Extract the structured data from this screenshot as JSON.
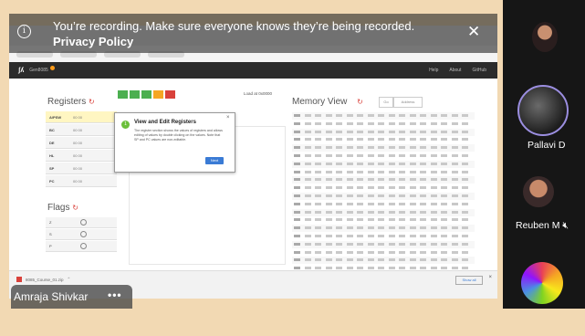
{
  "banner": {
    "message": "You’re recording. Make sure everyone knows they’re being recorded.",
    "link": "Privacy Policy",
    "info_icon": "info-icon",
    "close_icon": "close-icon"
  },
  "participants": [
    {
      "name": "",
      "icon": "avatar-photo"
    },
    {
      "name": "Pallavi D",
      "icon": "avatar-photo"
    },
    {
      "name": "Reuben M",
      "icon": "avatar-photo"
    },
    {
      "name": "",
      "icon": "avatar-gradient"
    }
  ],
  "presenter": {
    "name": "Amraja Shivkar",
    "more": "•••"
  },
  "app": {
    "name": "Gen8085",
    "links": [
      "Help",
      "About",
      "GitHub"
    ],
    "registers_title": "Registers",
    "registers": [
      {
        "name": "A/PSW",
        "value": "00 00"
      },
      {
        "name": "BC",
        "value": "00 00"
      },
      {
        "name": "DE",
        "value": "00 00"
      },
      {
        "name": "HL",
        "value": "00 00"
      },
      {
        "name": "SP",
        "value": "00 00"
      },
      {
        "name": "PC",
        "value": "00 00"
      }
    ],
    "flags_title": "Flags",
    "flags": [
      "Z",
      "S",
      "P"
    ],
    "load_text": "Load at 0x0000",
    "memory_title": "Memory View",
    "memory_btn1": "Go",
    "memory_btn2": "Address",
    "tooltip": {
      "step": "1",
      "title": "View and Edit Registers",
      "body": "The register section shows the values of registers and allows editing of values by double clicking on the values. Note that SP and PC values are non-editable.",
      "next": "Next"
    },
    "download": {
      "file": "8085_Course_01.zip",
      "show_all": "Show all"
    }
  },
  "colors": {
    "banner_bg": "#3a3a3a",
    "sidepanel_bg": "#161616",
    "tooltip_accent": "#6bbf3a",
    "next_button": "#3a7bd5",
    "toolbar": [
      "#4caf50",
      "#4caf50",
      "#4caf50",
      "#f5a623",
      "#d9413b"
    ]
  }
}
